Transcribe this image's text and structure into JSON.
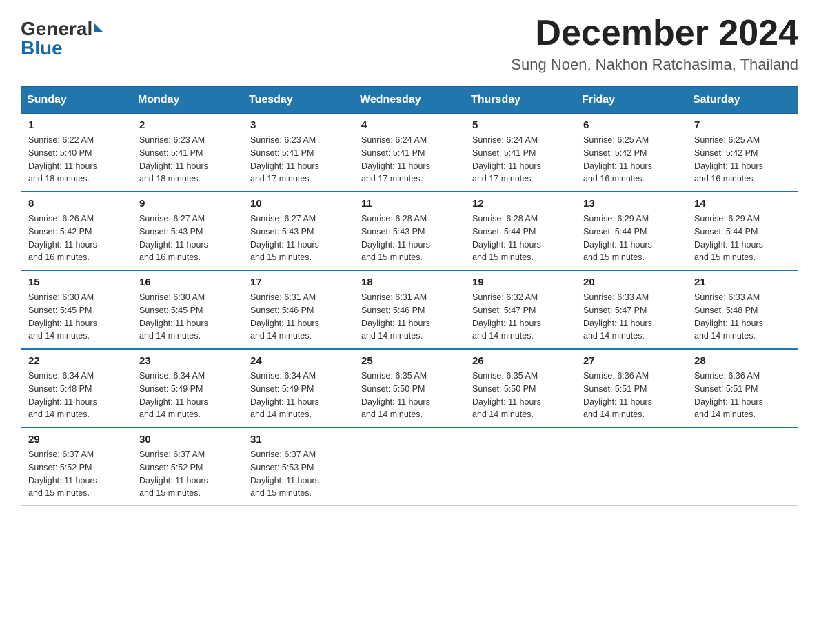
{
  "header": {
    "logo_general": "General",
    "logo_blue": "Blue",
    "month_title": "December 2024",
    "location": "Sung Noen, Nakhon Ratchasima, Thailand"
  },
  "weekdays": [
    "Sunday",
    "Monday",
    "Tuesday",
    "Wednesday",
    "Thursday",
    "Friday",
    "Saturday"
  ],
  "weeks": [
    [
      {
        "day": "1",
        "sunrise": "6:22 AM",
        "sunset": "5:40 PM",
        "daylight": "11 hours and 18 minutes."
      },
      {
        "day": "2",
        "sunrise": "6:23 AM",
        "sunset": "5:41 PM",
        "daylight": "11 hours and 18 minutes."
      },
      {
        "day": "3",
        "sunrise": "6:23 AM",
        "sunset": "5:41 PM",
        "daylight": "11 hours and 17 minutes."
      },
      {
        "day": "4",
        "sunrise": "6:24 AM",
        "sunset": "5:41 PM",
        "daylight": "11 hours and 17 minutes."
      },
      {
        "day": "5",
        "sunrise": "6:24 AM",
        "sunset": "5:41 PM",
        "daylight": "11 hours and 17 minutes."
      },
      {
        "day": "6",
        "sunrise": "6:25 AM",
        "sunset": "5:42 PM",
        "daylight": "11 hours and 16 minutes."
      },
      {
        "day": "7",
        "sunrise": "6:25 AM",
        "sunset": "5:42 PM",
        "daylight": "11 hours and 16 minutes."
      }
    ],
    [
      {
        "day": "8",
        "sunrise": "6:26 AM",
        "sunset": "5:42 PM",
        "daylight": "11 hours and 16 minutes."
      },
      {
        "day": "9",
        "sunrise": "6:27 AM",
        "sunset": "5:43 PM",
        "daylight": "11 hours and 16 minutes."
      },
      {
        "day": "10",
        "sunrise": "6:27 AM",
        "sunset": "5:43 PM",
        "daylight": "11 hours and 15 minutes."
      },
      {
        "day": "11",
        "sunrise": "6:28 AM",
        "sunset": "5:43 PM",
        "daylight": "11 hours and 15 minutes."
      },
      {
        "day": "12",
        "sunrise": "6:28 AM",
        "sunset": "5:44 PM",
        "daylight": "11 hours and 15 minutes."
      },
      {
        "day": "13",
        "sunrise": "6:29 AM",
        "sunset": "5:44 PM",
        "daylight": "11 hours and 15 minutes."
      },
      {
        "day": "14",
        "sunrise": "6:29 AM",
        "sunset": "5:44 PM",
        "daylight": "11 hours and 15 minutes."
      }
    ],
    [
      {
        "day": "15",
        "sunrise": "6:30 AM",
        "sunset": "5:45 PM",
        "daylight": "11 hours and 14 minutes."
      },
      {
        "day": "16",
        "sunrise": "6:30 AM",
        "sunset": "5:45 PM",
        "daylight": "11 hours and 14 minutes."
      },
      {
        "day": "17",
        "sunrise": "6:31 AM",
        "sunset": "5:46 PM",
        "daylight": "11 hours and 14 minutes."
      },
      {
        "day": "18",
        "sunrise": "6:31 AM",
        "sunset": "5:46 PM",
        "daylight": "11 hours and 14 minutes."
      },
      {
        "day": "19",
        "sunrise": "6:32 AM",
        "sunset": "5:47 PM",
        "daylight": "11 hours and 14 minutes."
      },
      {
        "day": "20",
        "sunrise": "6:33 AM",
        "sunset": "5:47 PM",
        "daylight": "11 hours and 14 minutes."
      },
      {
        "day": "21",
        "sunrise": "6:33 AM",
        "sunset": "5:48 PM",
        "daylight": "11 hours and 14 minutes."
      }
    ],
    [
      {
        "day": "22",
        "sunrise": "6:34 AM",
        "sunset": "5:48 PM",
        "daylight": "11 hours and 14 minutes."
      },
      {
        "day": "23",
        "sunrise": "6:34 AM",
        "sunset": "5:49 PM",
        "daylight": "11 hours and 14 minutes."
      },
      {
        "day": "24",
        "sunrise": "6:34 AM",
        "sunset": "5:49 PM",
        "daylight": "11 hours and 14 minutes."
      },
      {
        "day": "25",
        "sunrise": "6:35 AM",
        "sunset": "5:50 PM",
        "daylight": "11 hours and 14 minutes."
      },
      {
        "day": "26",
        "sunrise": "6:35 AM",
        "sunset": "5:50 PM",
        "daylight": "11 hours and 14 minutes."
      },
      {
        "day": "27",
        "sunrise": "6:36 AM",
        "sunset": "5:51 PM",
        "daylight": "11 hours and 14 minutes."
      },
      {
        "day": "28",
        "sunrise": "6:36 AM",
        "sunset": "5:51 PM",
        "daylight": "11 hours and 14 minutes."
      }
    ],
    [
      {
        "day": "29",
        "sunrise": "6:37 AM",
        "sunset": "5:52 PM",
        "daylight": "11 hours and 15 minutes."
      },
      {
        "day": "30",
        "sunrise": "6:37 AM",
        "sunset": "5:52 PM",
        "daylight": "11 hours and 15 minutes."
      },
      {
        "day": "31",
        "sunrise": "6:37 AM",
        "sunset": "5:53 PM",
        "daylight": "11 hours and 15 minutes."
      },
      null,
      null,
      null,
      null
    ]
  ],
  "labels": {
    "sunrise": "Sunrise:",
    "sunset": "Sunset:",
    "daylight": "Daylight:"
  }
}
